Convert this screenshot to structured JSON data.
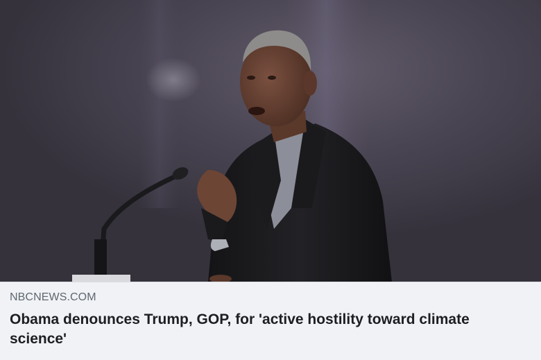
{
  "link_preview": {
    "domain": "NBCNEWS.COM",
    "headline": "Obama denounces Trump, GOP, for 'active hostility toward climate science'"
  },
  "photo": {
    "subject": "speaker-at-podium-photo",
    "background_color": "#433f4b",
    "jacket_color": "#1c1c1e",
    "shirt_color": "#8c8f99",
    "skin_color": "#6b4432",
    "hair_color": "#8e8c8a"
  },
  "colors": {
    "meta_background": "#f0f2f5",
    "domain_text": "#606770",
    "headline_text": "#1c1e21"
  }
}
